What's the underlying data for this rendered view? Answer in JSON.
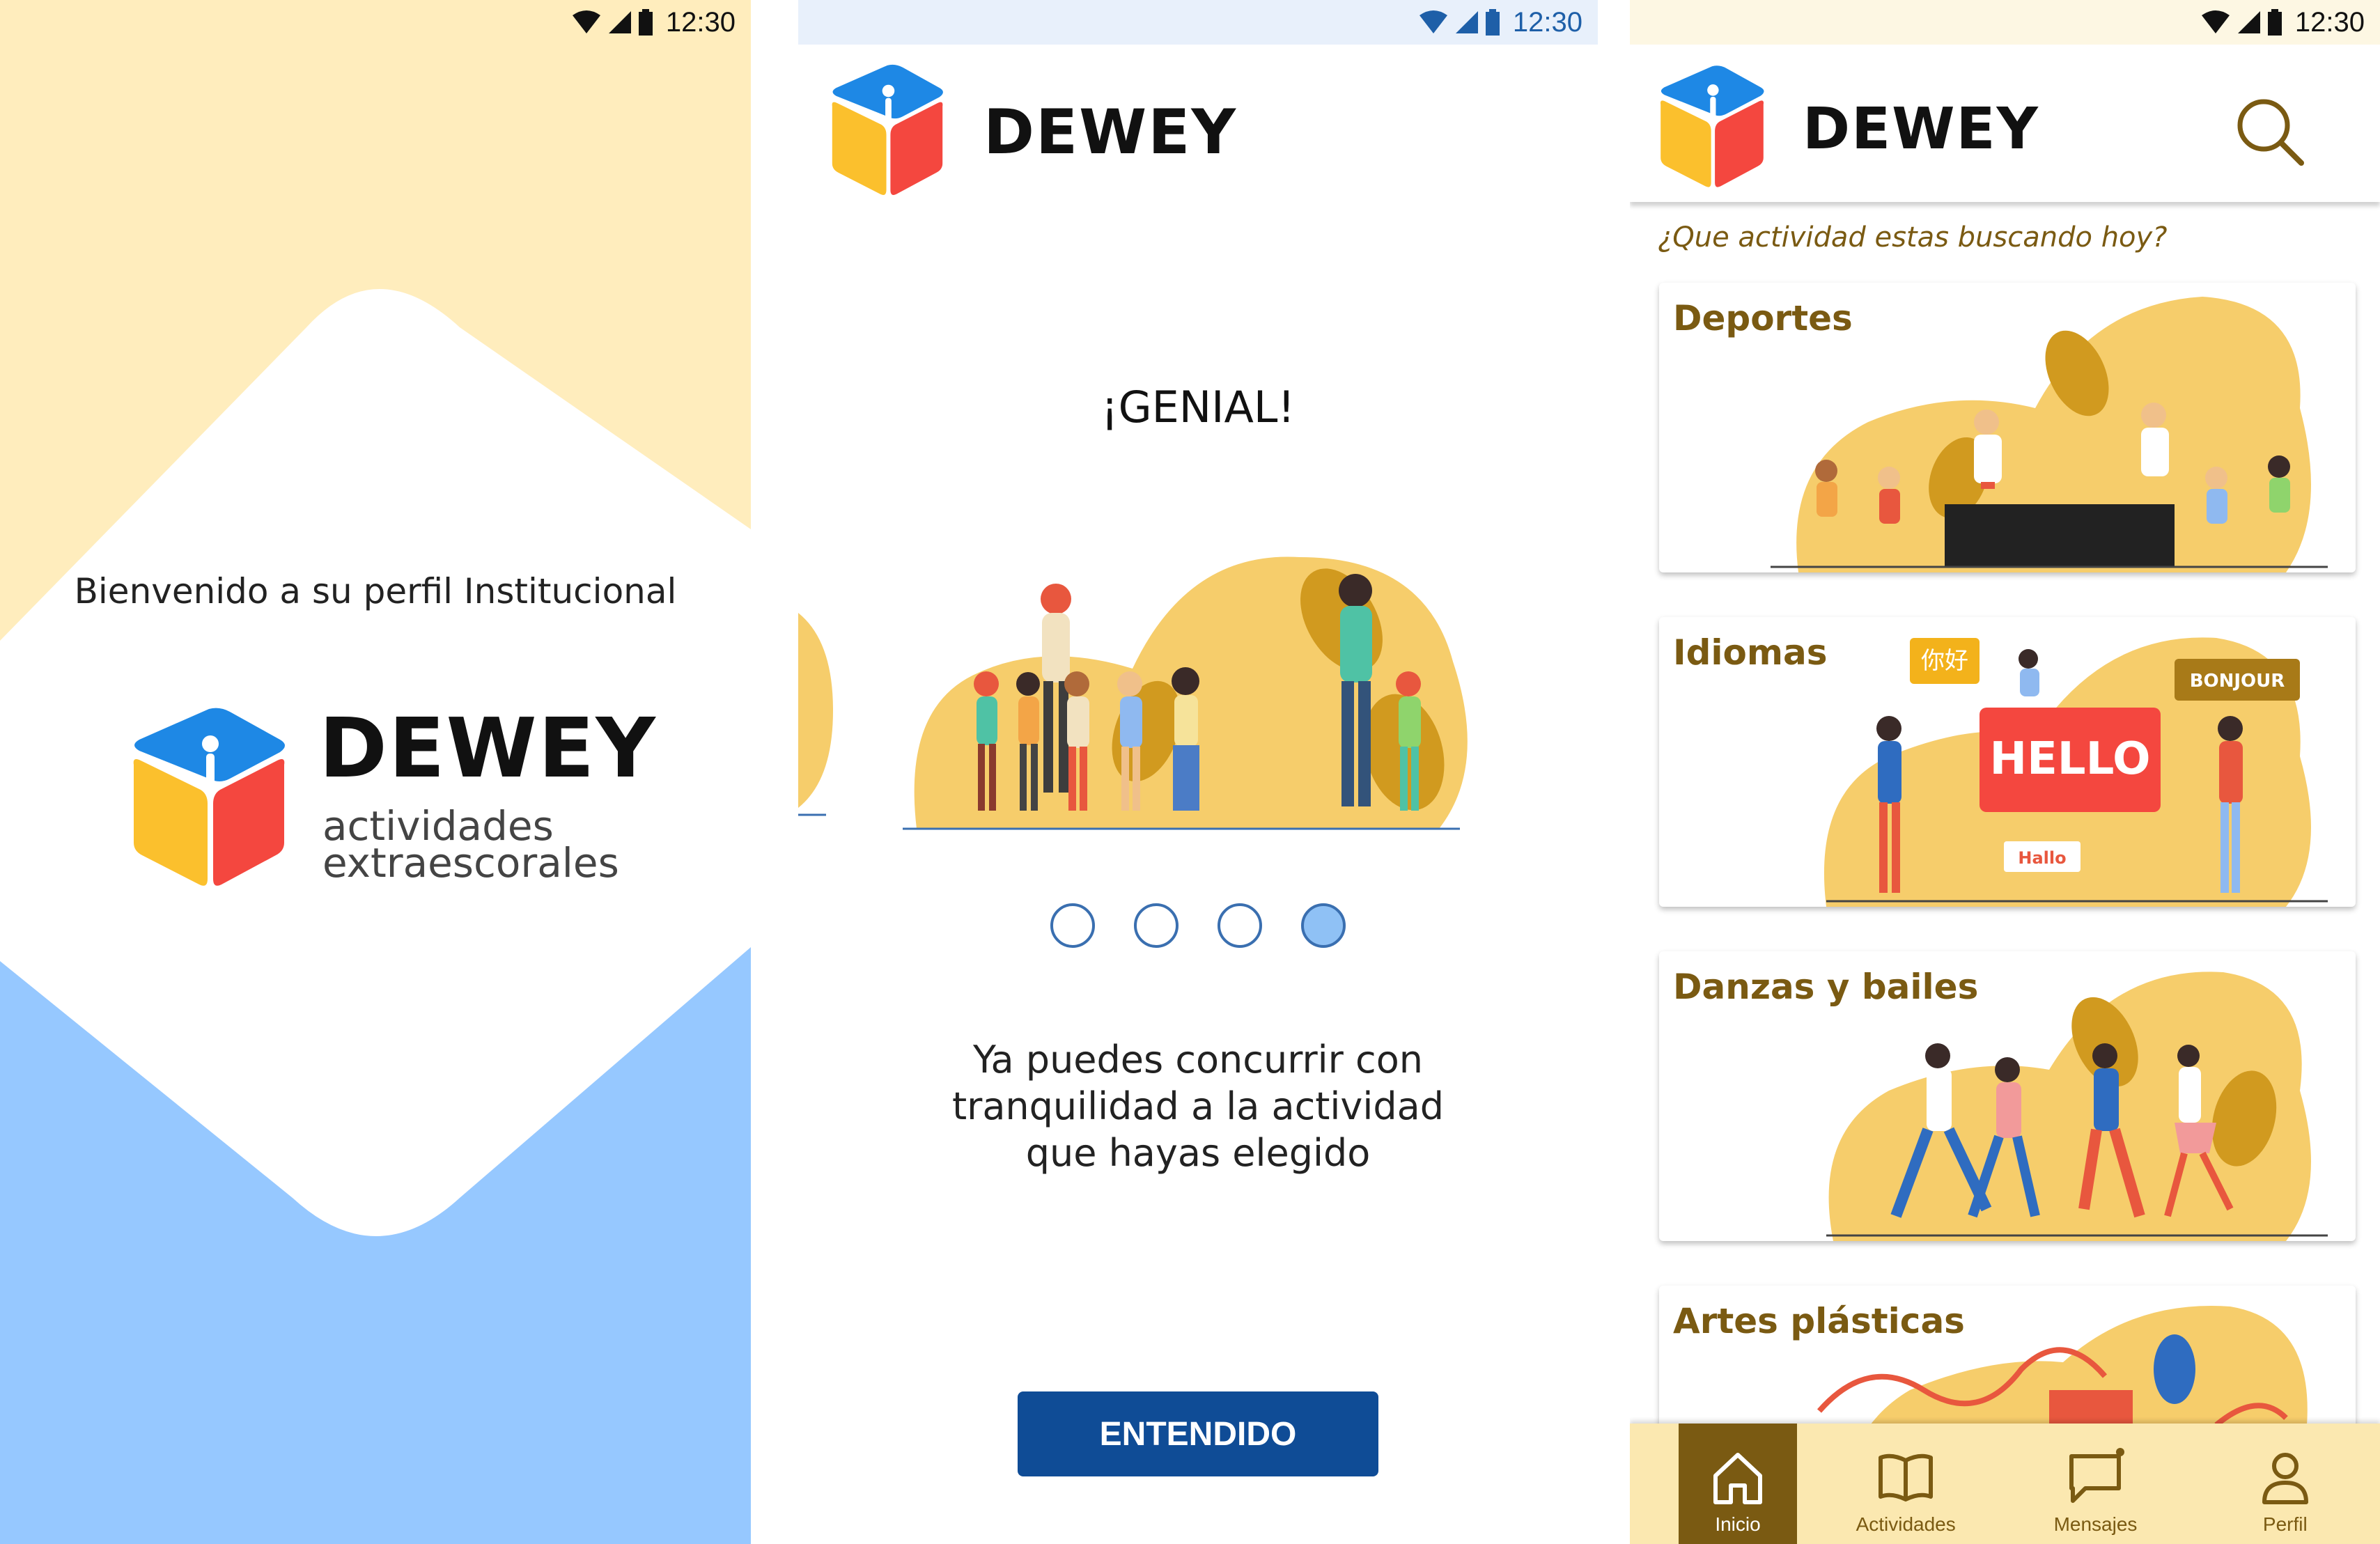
{
  "status_bar": {
    "time": "12:30"
  },
  "screen1": {
    "welcome": "Bienvenido a su perfil Institucional",
    "brand": "DEWEY",
    "subtitle_line1": "actividades",
    "subtitle_line2": "extraescorales"
  },
  "screen2": {
    "brand": "DEWEY",
    "title": "¡GENIAL!",
    "body_line1": "Ya puedes concurrir con",
    "body_line2": "tranquilidad a la actividad",
    "body_line3": "que hayas elegido",
    "pager": {
      "total": 4,
      "active": 4
    },
    "button": "ENTENDIDO"
  },
  "screen3": {
    "brand": "DEWEY",
    "question": "¿Que actividad estas buscando hoy?",
    "categories": [
      {
        "title": "Deportes"
      },
      {
        "title": "Idiomas",
        "illustration_text": [
          "你好",
          "HELLO",
          "BONJOUR",
          "Hallo"
        ]
      },
      {
        "title": "Danzas y bailes"
      },
      {
        "title": "Artes plásticas"
      }
    ],
    "tabs": [
      {
        "label": "Inicio",
        "icon": "home-icon",
        "active": true
      },
      {
        "label": "Actividades",
        "icon": "book-icon",
        "active": false
      },
      {
        "label": "Mensajes",
        "icon": "chat-icon",
        "active": false
      },
      {
        "label": "Perfil",
        "icon": "user-icon",
        "active": false
      }
    ]
  },
  "colors": {
    "brand_blue": "#1e88e5",
    "brand_yellow": "#fbc02d",
    "brand_red": "#f4473f",
    "accent_gold": "#7a5a12",
    "button_blue": "#0f4c96",
    "cream": "#ffedbd",
    "light_blue": "#96c8ff"
  }
}
